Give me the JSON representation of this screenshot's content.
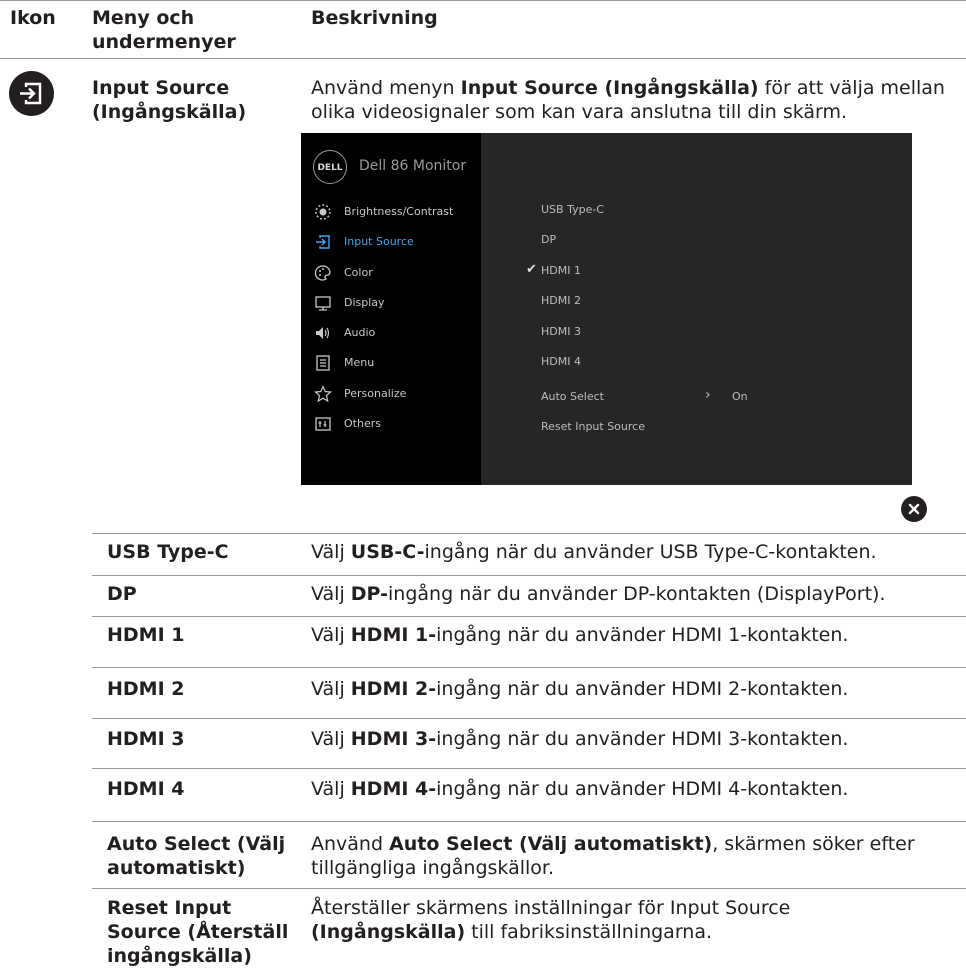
{
  "headers": {
    "icon": "Ikon",
    "menu": "Meny och undermenyer",
    "desc": "Beskrivning"
  },
  "main": {
    "icon": "input-source-icon",
    "title": "Input Source (Ingångskälla)",
    "desc_prefix": "Använd menyn",
    "desc_bold": "Input Source (Ingångskälla)",
    "desc_suffix": "för att välja mellan olika videosignaler som kan vara anslutna till din skärm."
  },
  "osd": {
    "logo": "DELL",
    "title": "Dell 86 Monitor",
    "menu": [
      {
        "label": "Brightness/Contrast",
        "icon": "sun-icon"
      },
      {
        "label": "Input Source",
        "icon": "input-source-icon"
      },
      {
        "label": "Color",
        "icon": "palette-icon"
      },
      {
        "label": "Display",
        "icon": "monitor-icon"
      },
      {
        "label": "Audio",
        "icon": "speaker-icon"
      },
      {
        "label": "Menu",
        "icon": "document-icon"
      },
      {
        "label": "Personalize",
        "icon": "star-icon"
      },
      {
        "label": "Others",
        "icon": "others-icon"
      }
    ],
    "options": [
      "USB Type-C",
      "DP",
      "HDMI 1",
      "HDMI 2",
      "HDMI 3",
      "HDMI 4",
      "Auto Select",
      "Reset Input Source"
    ],
    "selected": "HDMI 1",
    "auto_value": "On",
    "accent": "#4aa3e8"
  },
  "rows": [
    {
      "name": "USB Type-C",
      "pre": "Välj",
      "bold": "USB-C-",
      "post": "ingång när du använder USB Type-C-kontakten."
    },
    {
      "name": "DP",
      "pre": "Välj",
      "bold": "DP-",
      "post": "ingång när du använder DP-kontakten (DisplayPort)."
    },
    {
      "name": "HDMI 1",
      "pre": "Välj",
      "bold": "HDMI 1-",
      "post": "ingång när du använder HDMI 1-kontakten."
    },
    {
      "name": "HDMI 2",
      "pre": "Välj",
      "bold": "HDMI 2-",
      "post": "ingång när du använder HDMI 2-kontakten."
    },
    {
      "name": "HDMI 3",
      "pre": "Välj",
      "bold": "HDMI 3-",
      "post": "ingång när du använder HDMI 3-kontakten."
    },
    {
      "name": "HDMI 4",
      "pre": "Välj",
      "bold": "HDMI 4-",
      "post": "ingång när du använder HDMI 4-kontakten."
    }
  ],
  "auto_row": {
    "name": "Auto Select (Välj automatiskt)",
    "pre": "Använd",
    "bold": "Auto Select (Välj automatiskt)",
    "post": ", skärmen söker efter tillgängliga ingångskällor."
  },
  "reset_row": {
    "name": "Reset Input Source (Återställ ingångskälla)",
    "pre": "Återställer skärmens inställningar för",
    "mid1": "Input Source",
    "mid2": "(Ingångskälla)",
    "post": "till fabriksinställningarna."
  }
}
